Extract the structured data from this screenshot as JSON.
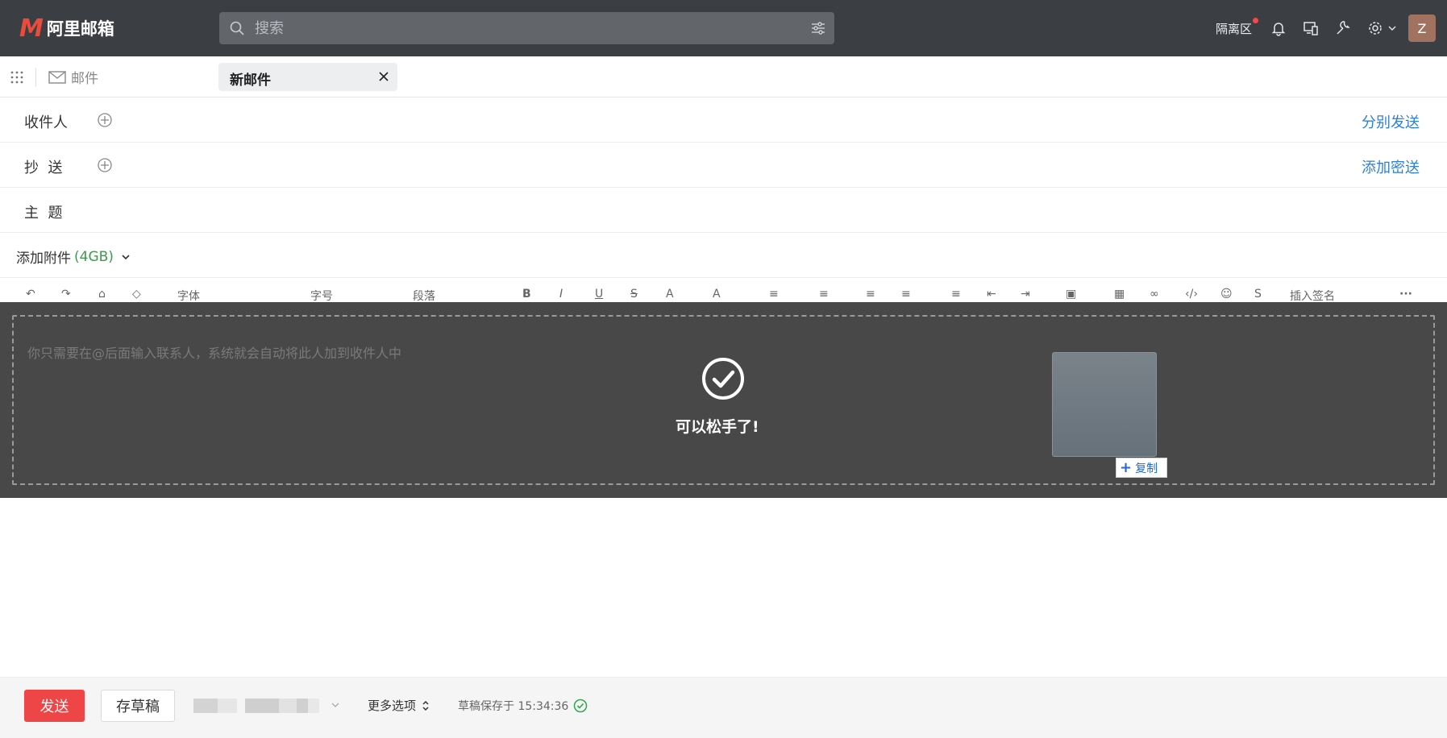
{
  "app": {
    "logo_mark": "M",
    "logo_name": "阿里邮箱"
  },
  "search": {
    "placeholder": "搜索"
  },
  "header": {
    "quarantine_label": "隔离区",
    "avatar_letter": "Z"
  },
  "tabs": {
    "mail_label": "邮件",
    "compose_label": "新邮件"
  },
  "compose": {
    "to_label": "收件人",
    "cc_label": "抄  送",
    "subject_label": "主  题",
    "separate_send": "分别发送",
    "add_bcc": "添加密送",
    "attach_label": "添加附件",
    "attach_size": "(4GB)"
  },
  "toolbar": {
    "font_label": "字体",
    "size_label": "字号",
    "paragraph_label": "段落",
    "signature_label": "插入签名"
  },
  "editor": {
    "placeholder": "你只需要在@后面输入联系人，系统就会自动将此人加到收件人中"
  },
  "drop_overlay": {
    "message": "可以松手了!",
    "copy_label": "复制"
  },
  "footer": {
    "send_label": "发送",
    "draft_label": "存草稿",
    "more_options": "更多选项",
    "draft_saved": "草稿保存于 15:34:36"
  },
  "colors": {
    "topbar": "#3b3f44",
    "accent_red": "#ee4646",
    "link_blue": "#2f7fd2",
    "size_green": "#3a9b4b"
  }
}
